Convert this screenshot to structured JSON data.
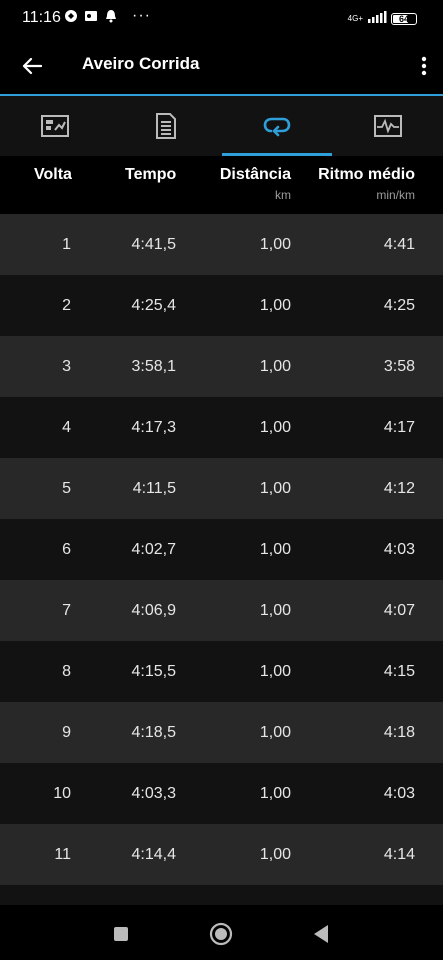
{
  "status": {
    "time": "11:16",
    "dots": "···",
    "network": "4G+",
    "battery": "64"
  },
  "app": {
    "title": "Aveiro Corrida"
  },
  "tabs": [
    {
      "icon": "summary-chart-icon",
      "active": false
    },
    {
      "icon": "details-list-icon",
      "active": false
    },
    {
      "icon": "laps-icon",
      "active": true
    },
    {
      "icon": "graph-icon",
      "active": false
    }
  ],
  "table": {
    "headers": {
      "lap": "Volta",
      "time": "Tempo",
      "distance": "Distância",
      "distance_unit": "km",
      "pace": "Ritmo médio",
      "pace_unit": "min/km"
    },
    "rows": [
      {
        "lap": "1",
        "time": "4:41,5",
        "distance": "1,00",
        "pace": "4:41"
      },
      {
        "lap": "2",
        "time": "4:25,4",
        "distance": "1,00",
        "pace": "4:25"
      },
      {
        "lap": "3",
        "time": "3:58,1",
        "distance": "1,00",
        "pace": "3:58"
      },
      {
        "lap": "4",
        "time": "4:17,3",
        "distance": "1,00",
        "pace": "4:17"
      },
      {
        "lap": "5",
        "time": "4:11,5",
        "distance": "1,00",
        "pace": "4:12"
      },
      {
        "lap": "6",
        "time": "4:02,7",
        "distance": "1,00",
        "pace": "4:03"
      },
      {
        "lap": "7",
        "time": "4:06,9",
        "distance": "1,00",
        "pace": "4:07"
      },
      {
        "lap": "8",
        "time": "4:15,5",
        "distance": "1,00",
        "pace": "4:15"
      },
      {
        "lap": "9",
        "time": "4:18,5",
        "distance": "1,00",
        "pace": "4:18"
      },
      {
        "lap": "10",
        "time": "4:03,3",
        "distance": "1,00",
        "pace": "4:03"
      },
      {
        "lap": "11",
        "time": "4:14,4",
        "distance": "1,00",
        "pace": "4:14"
      }
    ]
  },
  "colors": {
    "accent": "#2f9fd9",
    "row_light": "#282828",
    "row_dark": "#121212"
  }
}
